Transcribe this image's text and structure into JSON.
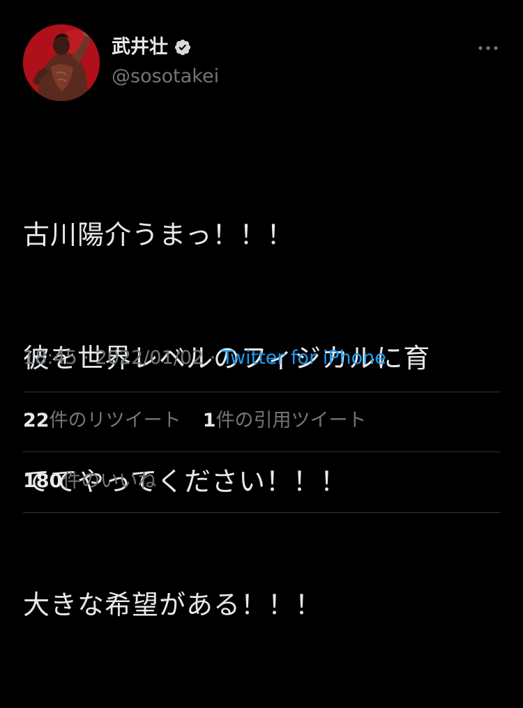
{
  "author": {
    "display_name": "武井壮",
    "handle": "@sosotakei",
    "verified": true,
    "avatar_icon": "profile-photo-avatar"
  },
  "more_icon": "more-options-icon",
  "tweet": {
    "lines": [
      "古川陽介うまっ！！！",
      "彼を世界レベルのフィジカルに育",
      "ててやってください！！！",
      "大きな希望がある！！！"
    ],
    "time": "18:45",
    "date": "2022/01/02",
    "separator": "·",
    "source": "Twitter for iPhone"
  },
  "stats": {
    "retweets_count": "22",
    "retweets_label": "件のリツイート",
    "quotes_count": "1",
    "quotes_label": "件の引用ツイート",
    "likes_count": "180",
    "likes_label": "件のいいね"
  },
  "colors": {
    "background": "#000000",
    "text": "#e7e9ea",
    "secondary": "#71767b",
    "link": "#1d9bf0",
    "verified_badge": "#d9d9d9",
    "divider": "#2f3336"
  }
}
